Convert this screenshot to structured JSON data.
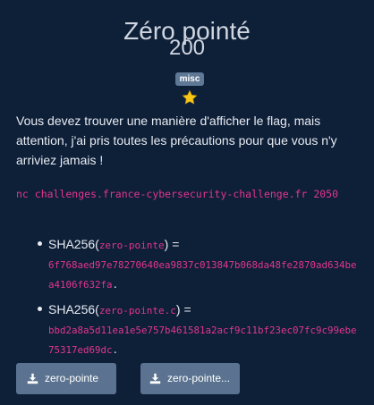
{
  "challenge": {
    "title": "Zéro pointé",
    "points": "200",
    "category": "misc",
    "difficulty_icon": "star-icon",
    "description": "Vous devez trouver une manière d'afficher le flag, mais attention, j'ai pris toutes les précautions pour que vous n'y arriviez jamais !",
    "connection": "nc challenges.france-cybersecurity-challenge.fr 2050"
  },
  "hashes": [
    {
      "prefix": "SHA256(",
      "file": "zero-pointe",
      "suffix": ") =",
      "value": "6f768aed97e78270640ea9837c013847b068da48fe2870ad634bea4106f632fa",
      "end": "."
    },
    {
      "prefix": "SHA256(",
      "file": "zero-pointe.c",
      "suffix": ") =",
      "value": "bbd2a8a5d11ea1e5e757b461581a2acf9c11bf23ec07fc9c99ebe75317ed69dc",
      "end": "."
    }
  ],
  "downloads": [
    {
      "label": "zero-pointe",
      "icon": "download-icon"
    },
    {
      "label": "zero-pointe...",
      "icon": "download-icon"
    }
  ],
  "colors": {
    "background": "#0e1f38",
    "accent": "#e2368f",
    "button": "#5b7390",
    "badge": "#5f7896",
    "star": "#f5c518"
  }
}
